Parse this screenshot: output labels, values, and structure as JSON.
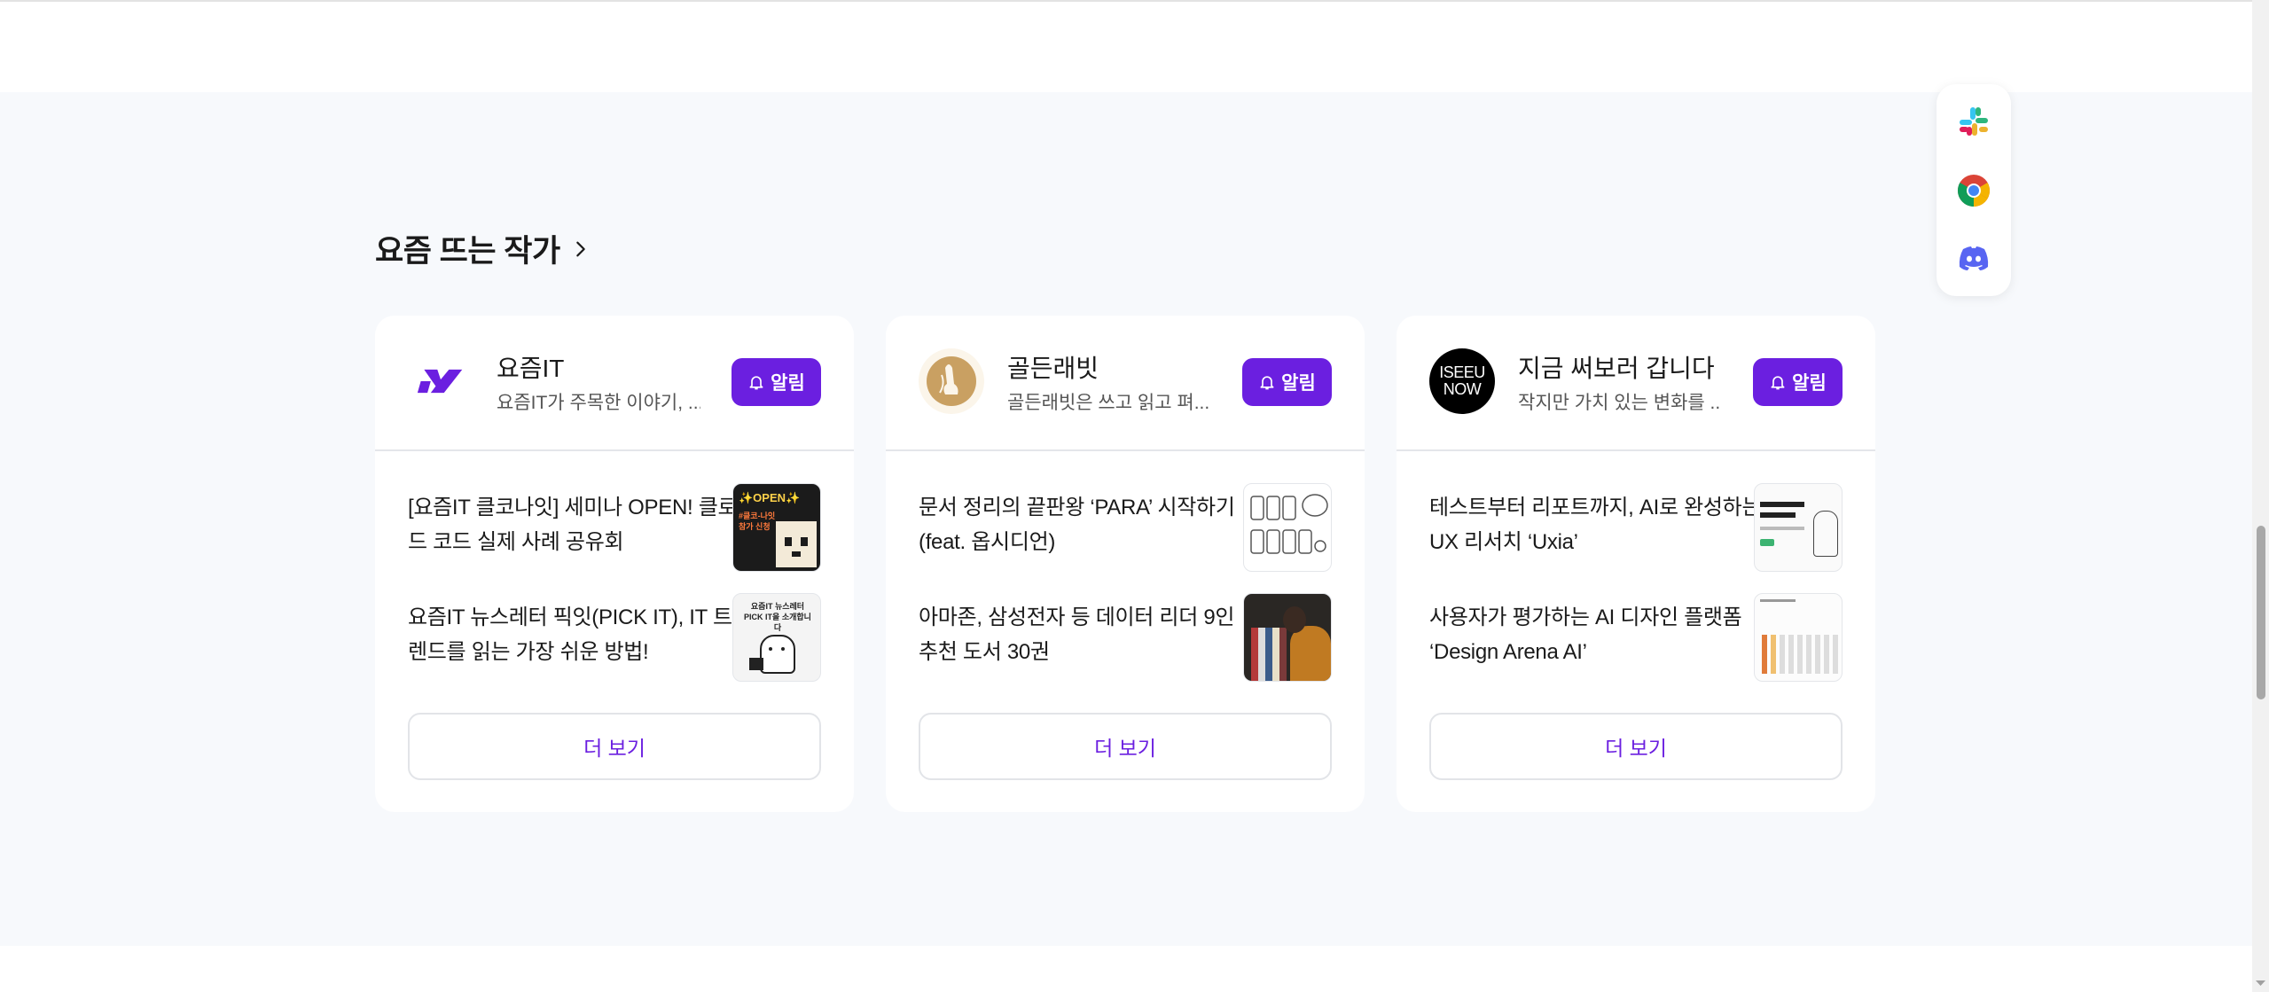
{
  "section": {
    "title": "요즘 뜨는 작가"
  },
  "authors": [
    {
      "name": "요즘IT",
      "desc": "요즘IT가 주목한 이야기, ...",
      "alarm_label": "알림",
      "posts": [
        {
          "title": "[요즘IT 클코나잇] 세미나 OPEN! 클로드 코드 실제 사례 공유회"
        },
        {
          "title": "요즘IT 뉴스레터 픽잇(PICK IT), IT 트렌드를 읽는 가장 쉬운 방법!"
        }
      ],
      "more_label": "더 보기"
    },
    {
      "name": "골든래빗",
      "desc": "골든래빗은 쓰고 읽고 펴...",
      "alarm_label": "알림",
      "posts": [
        {
          "title": "문서 정리의 끝판왕 ‘PARA’ 시작하기(feat. 옵시디언)"
        },
        {
          "title": "아마존, 삼성전자 등 데이터 리더 9인 추천 도서 30권"
        }
      ],
      "more_label": "더 보기"
    },
    {
      "name": "지금 써보러 갑니다",
      "desc": "작지만 가치 있는 변화를 ...",
      "alarm_label": "알림",
      "posts": [
        {
          "title": "테스트부터 리포트까지, AI로 완성하는 UX 리서치 ‘Uxia’"
        },
        {
          "title": "사용자가 평가하는 AI 디자인 플랫폼 ‘Design Arena AI’"
        }
      ],
      "more_label": "더 보기"
    }
  ],
  "thumbnails": {
    "open_banner": "✨OPEN✨",
    "open_sub": "#클코-나잇 참가 신청",
    "newsletter": "요즘IT 뉴스레터 PICK IT을 소개합니다",
    "golden_logo": "",
    "iseeu_logo": "ISEEU NOW"
  },
  "colors": {
    "accent": "#6b1fe0",
    "section_bg": "#f7f9fc"
  },
  "float_icons": [
    "slack-icon",
    "chrome-icon",
    "discord-icon"
  ]
}
